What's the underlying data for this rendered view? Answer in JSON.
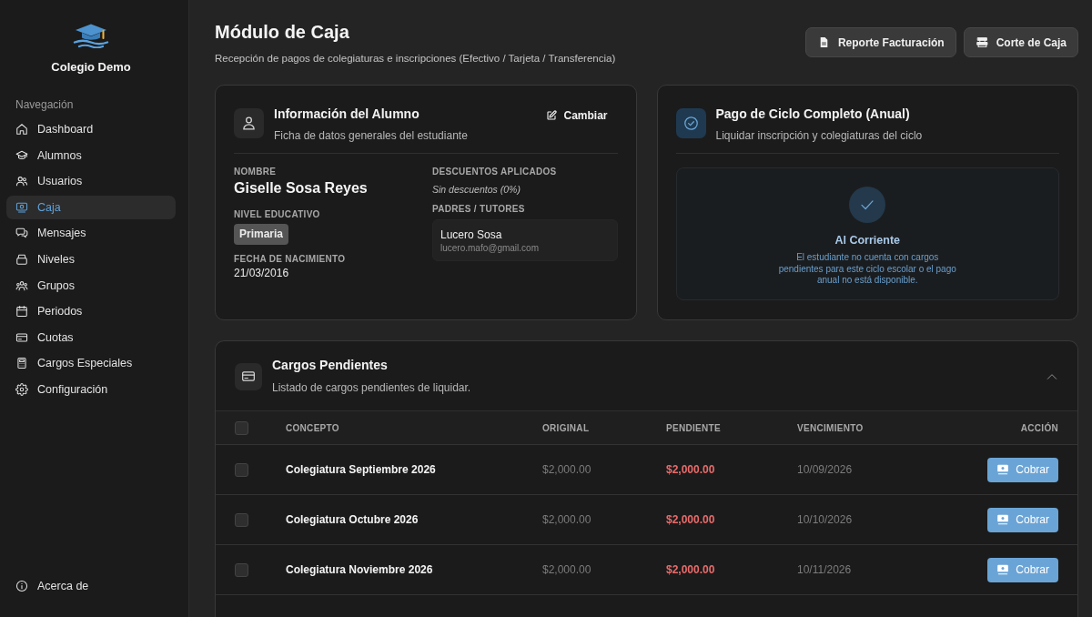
{
  "sidebar": {
    "brand": "Colegio Demo",
    "section_label": "Navegación",
    "items": [
      {
        "label": "Dashboard",
        "selected": false
      },
      {
        "label": "Alumnos",
        "selected": false
      },
      {
        "label": "Usuarios",
        "selected": false
      },
      {
        "label": "Caja",
        "selected": true
      },
      {
        "label": "Mensajes",
        "selected": false
      },
      {
        "label": "Niveles",
        "selected": false
      },
      {
        "label": "Grupos",
        "selected": false
      },
      {
        "label": "Periodos",
        "selected": false
      },
      {
        "label": "Cuotas",
        "selected": false
      },
      {
        "label": "Cargos Especiales",
        "selected": false
      },
      {
        "label": "Configuración",
        "selected": false
      }
    ],
    "footer_items": [
      {
        "label": "Acerca de",
        "selected": false
      }
    ]
  },
  "header": {
    "title": "Módulo de Caja",
    "subtitle": "Recepción de pagos de colegiaturas e inscripciones (Efectivo / Tarjeta / Transferencia)",
    "buttons": [
      {
        "label": "Reporte Facturación"
      },
      {
        "label": "Corte de Caja"
      }
    ]
  },
  "student": {
    "title": "Información del Alumno",
    "subtitle": "Ficha de datos generales del estudiante",
    "action": "Cambiar",
    "fields": [
      {
        "kind": "name",
        "label": "NOMBRE",
        "value": "Giselle Sosa Reyes"
      },
      {
        "kind": "badge",
        "label": "NIVEL EDUCATIVO",
        "value": "Primaria"
      },
      {
        "kind": "text",
        "label": "FECHA DE NACIMIENTO",
        "value": "21/03/2016"
      }
    ],
    "discounts": {
      "label": "DESCUENTOS APLICADOS",
      "value": "Sin descuentos (0%)"
    },
    "tutors": {
      "label": "PADRES / TUTORES",
      "items": [
        {
          "name": "Lucero Sosa",
          "email": "lucero.mafo@gmail.com"
        }
      ]
    }
  },
  "annual_payment": {
    "title": "Pago de Ciclo Completo (Anual)",
    "subtitle": "Liquidar inscripción y colegiaturas del ciclo",
    "status": {
      "title": "Al Corriente",
      "message": "El estudiante no cuenta con cargos pendientes para este ciclo escolar o el pago anual no está disponible."
    }
  },
  "pending_charges": {
    "title": "Cargos Pendientes",
    "subtitle": "Listado de cargos pendientes de liquidar.",
    "expanded": true,
    "select_all_checked": false,
    "columns": [
      "CONCEPTO",
      "ORIGINAL",
      "PENDIENTE",
      "VENCIMIENTO",
      "ACCIÓN"
    ],
    "rows": [
      {
        "checked": false,
        "concept": "Colegiatura Septiembre 2026",
        "original": "$2,000.00",
        "pending": "$2,000.00",
        "due": "10/09/2026",
        "action": "Cobrar"
      },
      {
        "checked": false,
        "concept": "Colegiatura Octubre 2026",
        "original": "$2,000.00",
        "pending": "$2,000.00",
        "due": "10/10/2026",
        "action": "Cobrar"
      },
      {
        "checked": false,
        "concept": "Colegiatura Noviembre 2026",
        "original": "$2,000.00",
        "pending": "$2,000.00",
        "due": "10/11/2026",
        "action": "Cobrar"
      }
    ]
  }
}
